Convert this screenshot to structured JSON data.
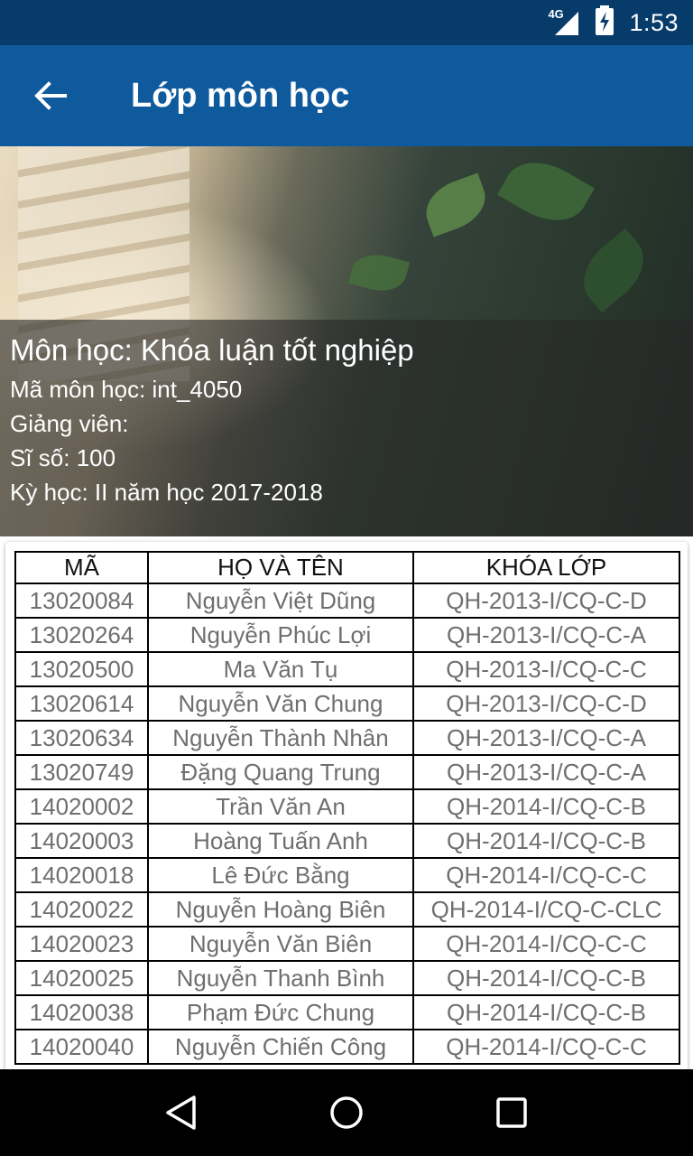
{
  "status_bar": {
    "network": "4G",
    "time": "1:53",
    "icons": [
      "signal-icon",
      "battery-charging-icon"
    ]
  },
  "app_bar": {
    "title": "Lớp môn học",
    "back_icon": "arrow-left-icon"
  },
  "course": {
    "subject": "Môn học: Khóa luận tốt nghiệp",
    "code": "Mã môn học: int_4050",
    "lecturer": "Giảng viên:",
    "size": "Sĩ số: 100",
    "semester": "Kỳ học: II năm học 2017-2018"
  },
  "table": {
    "headers": [
      "MÃ",
      "HỌ VÀ TÊN",
      "KHÓA LỚP"
    ],
    "rows": [
      [
        "13020084",
        "Nguyễn Việt Dũng",
        "QH-2013-I/CQ-C-D"
      ],
      [
        "13020264",
        "Nguyễn Phúc Lợi",
        "QH-2013-I/CQ-C-A"
      ],
      [
        "13020500",
        "Ma Văn Tụ",
        "QH-2013-I/CQ-C-C"
      ],
      [
        "13020614",
        "Nguyễn Văn Chung",
        "QH-2013-I/CQ-C-D"
      ],
      [
        "13020634",
        "Nguyễn Thành Nhân",
        "QH-2013-I/CQ-C-A"
      ],
      [
        "13020749",
        "Đặng Quang Trung",
        "QH-2013-I/CQ-C-A"
      ],
      [
        "14020002",
        "Trần Văn An",
        "QH-2014-I/CQ-C-B"
      ],
      [
        "14020003",
        "Hoàng Tuấn Anh",
        "QH-2014-I/CQ-C-B"
      ],
      [
        "14020018",
        "Lê Đức Bằng",
        "QH-2014-I/CQ-C-C"
      ],
      [
        "14020022",
        "Nguyễn Hoàng Biên",
        "QH-2014-I/CQ-C-CLC"
      ],
      [
        "14020023",
        "Nguyễn Văn Biên",
        "QH-2014-I/CQ-C-C"
      ],
      [
        "14020025",
        "Nguyễn Thanh Bình",
        "QH-2014-I/CQ-C-B"
      ],
      [
        "14020038",
        "Phạm Đức Chung",
        "QH-2014-I/CQ-C-B"
      ],
      [
        "14020040",
        "Nguyễn Chiến Công",
        "QH-2014-I/CQ-C-C"
      ]
    ]
  },
  "nav_bar": {
    "icons": [
      "back-triangle-icon",
      "home-circle-icon",
      "recents-square-icon"
    ]
  },
  "colors": {
    "status_bar": "#073b6a",
    "app_bar": "#0f5a9c"
  }
}
